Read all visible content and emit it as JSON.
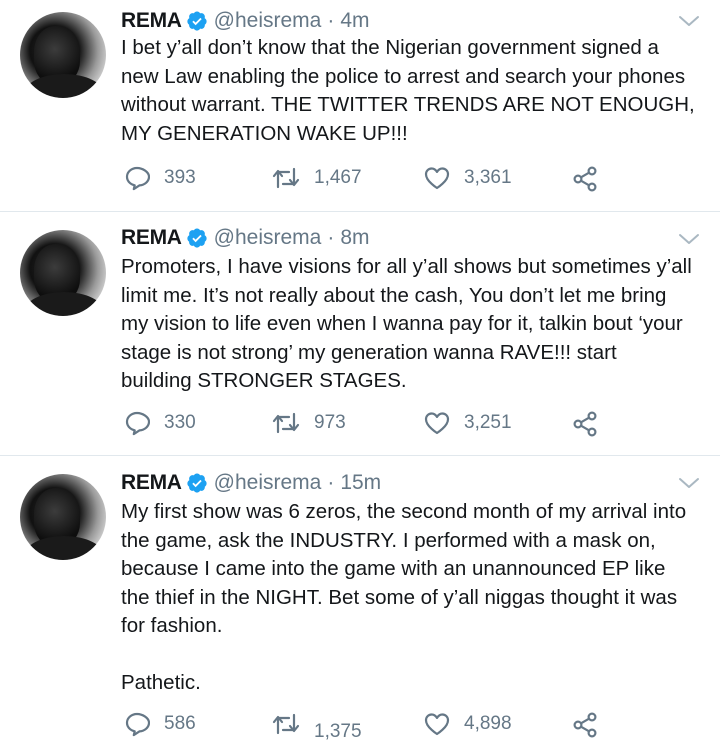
{
  "tweets": [
    {
      "name": "REMA",
      "handle": "@heisrema",
      "time": "4m",
      "text": "I bet y’all don’t know that the Nigerian government signed a\nnew Law enabling the police to arrest and search your phones\nwithout warrant. THE TWITTER TRENDS ARE NOT ENOUGH,\nMY GENERATION WAKE UP!!!",
      "replies": "393",
      "retweets": "1,467",
      "likes": "3,361"
    },
    {
      "name": "REMA",
      "handle": "@heisrema",
      "time": "8m",
      "text": "Promoters, I have visions for all y’all shows but sometimes y’all\nlimit me. It’s not really about the cash, You don’t let me bring\nmy vision to life even when I wanna pay for it, talkin bout ‘your\nstage is not strong’ my generation wanna RAVE!!! start\nbuilding STRONGER STAGES.",
      "replies": "330",
      "retweets": "973",
      "likes": "3,251"
    },
    {
      "name": "REMA",
      "handle": "@heisrema",
      "time": "15m",
      "text": "My first show was 6 zeros, the second month of my arrival into\nthe game, ask the INDUSTRY. I performed with a mask on,\nbecause I came into the game with an unannounced EP like\nthe thief in the NIGHT. Bet some of y’all niggas thought it was\nfor fashion.\n\nPathetic.",
      "replies": "586",
      "retweets": "1,375",
      "likes": "4,898"
    }
  ],
  "icons": {
    "verified": "verified-badge-icon",
    "menu": "chevron-down-icon",
    "reply": "reply-icon",
    "retweet": "retweet-icon",
    "like": "heart-icon",
    "share": "share-icon"
  },
  "colors": {
    "verified": "#1da1f2",
    "muted": "#657786",
    "text": "#14171a",
    "divider": "#e1e8ed"
  }
}
